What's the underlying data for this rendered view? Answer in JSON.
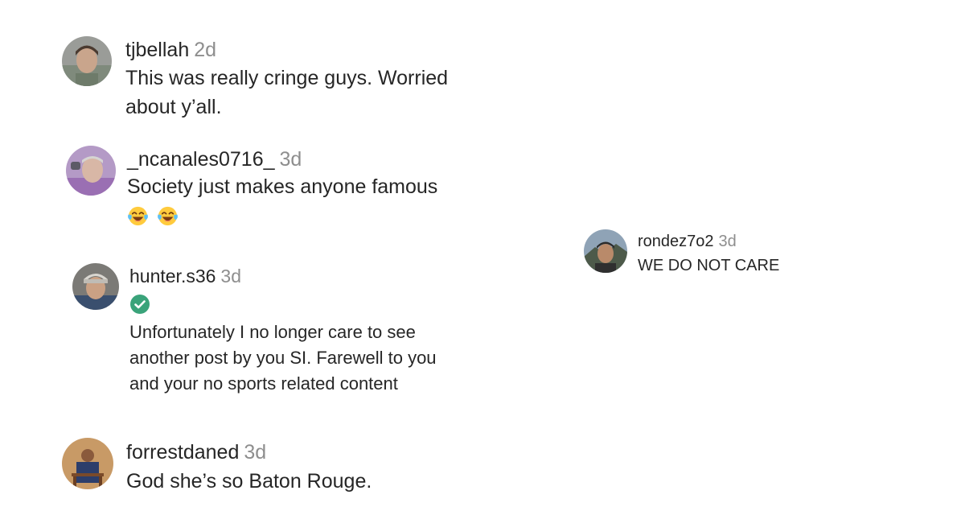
{
  "comments": [
    {
      "username": "tjbellah",
      "time": "2d",
      "text": "This was really cringe guys. Worried about y’all."
    },
    {
      "username": "_ncanales0716_",
      "time": "3d",
      "text": "Society just makes anyone famous",
      "emojis": [
        "face-with-tears-of-joy",
        "face-with-tears-of-joy"
      ]
    },
    {
      "username": "hunter.s36",
      "time": "3d",
      "verified": true,
      "text": "Unfortunately I no longer care to see another post by you SI. Farewell to you and your no sports related content"
    },
    {
      "username": "forrestdaned",
      "time": "3d",
      "text": "God she’s so Baton Rouge."
    },
    {
      "username": "rondez7o2",
      "time": "3d",
      "text": "WE DO NOT CARE"
    }
  ],
  "colors": {
    "username": "#262626",
    "timestamp": "#8e8e8e",
    "verified_badge": "#3aa37a",
    "background": "#ffffff"
  }
}
